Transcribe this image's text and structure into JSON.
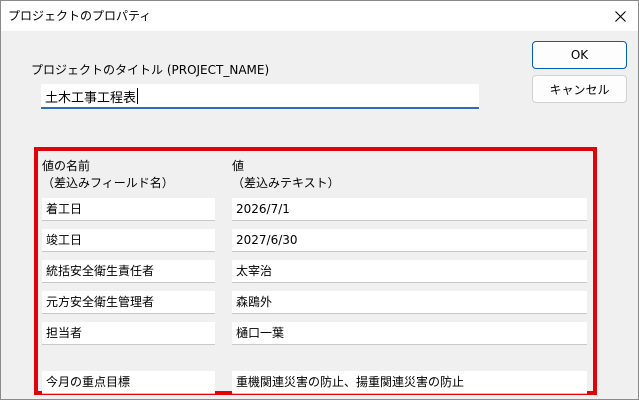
{
  "window": {
    "title": "プロジェクトのプロパティ",
    "close_glyph": "close-icon"
  },
  "project": {
    "label": "プロジェクトのタイトル (PROJECT_NAME)",
    "value": "土木工事工程表"
  },
  "buttons": {
    "ok": "OK",
    "cancel": "キャンセル"
  },
  "table": {
    "name_header_line1": "値の名前",
    "name_header_line2": "（差込みフィールド名）",
    "value_header_line1": "値",
    "value_header_line2": "（差込みテキスト）",
    "rows": [
      {
        "name": "着工日",
        "value": "2026/7/1"
      },
      {
        "name": "竣工日",
        "value": "2027/6/30"
      },
      {
        "name": "統括安全衛生責任者",
        "value": "太宰治"
      },
      {
        "name": "元方安全衛生管理者",
        "value": "森鴎外"
      },
      {
        "name": "担当者",
        "value": "樋口一葉"
      },
      {
        "name": "今月の重点目標",
        "value": "重機関連災害の防止、揚重関連災害の防止"
      }
    ]
  },
  "colors": {
    "highlight_border": "#e0040a",
    "focus_underline": "#2d6db5",
    "default_button_border": "#005fb8"
  }
}
